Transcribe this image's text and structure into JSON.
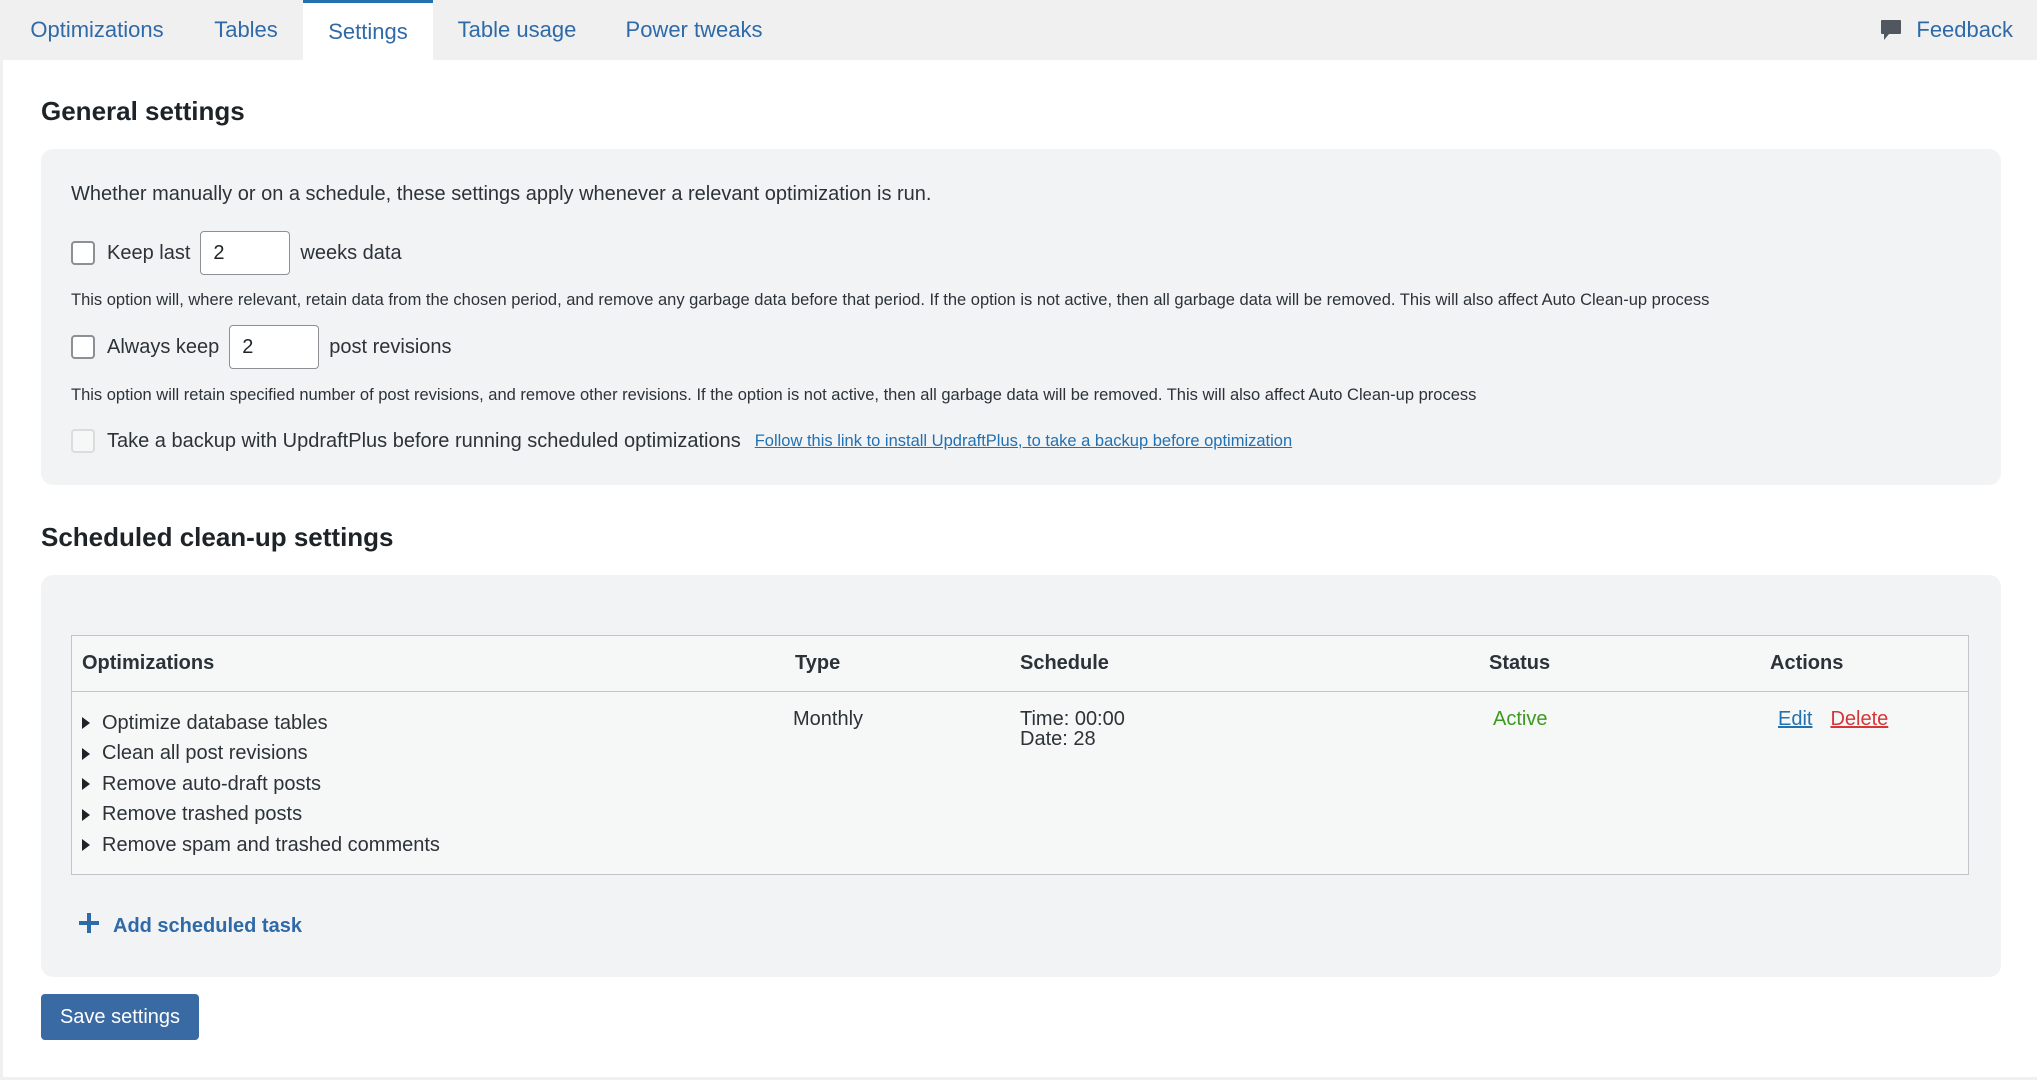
{
  "tabs": [
    {
      "label": "Optimizations",
      "active": false
    },
    {
      "label": "Tables",
      "active": false
    },
    {
      "label": "Settings",
      "active": true
    },
    {
      "label": "Table usage",
      "active": false
    },
    {
      "label": "Power tweaks",
      "active": false
    }
  ],
  "feedback": {
    "label": "Feedback",
    "icon": "speech-bubble-icon"
  },
  "general": {
    "title": "General settings",
    "intro": "Whether manually or on a schedule, these settings apply whenever a relevant optimization is run.",
    "keep_last": {
      "checked": false,
      "label_before": "Keep last",
      "value": "2",
      "label_after": "weeks data",
      "help": "This option will, where relevant, retain data from the chosen period, and remove any garbage data before that period. If the option is not active, then all garbage data will be removed. This will also affect Auto Clean-up process"
    },
    "always_keep": {
      "checked": false,
      "label_before": "Always keep",
      "value": "2",
      "label_after": "post revisions",
      "help": "This option will retain specified number of post revisions, and remove other revisions. If the option is not active, then all garbage data will be removed. This will also affect Auto Clean-up process"
    },
    "backup": {
      "checked": false,
      "disabled": true,
      "label": "Take a backup with UpdraftPlus before running scheduled optimizations",
      "link": "Follow this link to install UpdraftPlus, to take a backup before optimization"
    }
  },
  "scheduled": {
    "title": "Scheduled clean-up settings",
    "columns": {
      "optimizations": "Optimizations",
      "type": "Type",
      "schedule": "Schedule",
      "status": "Status",
      "actions": "Actions"
    },
    "row": {
      "optimizations": [
        "Optimize database tables",
        "Clean all post revisions",
        "Remove auto-draft posts",
        "Remove trashed posts",
        "Remove spam and trashed comments"
      ],
      "type": "Monthly",
      "schedule_time": "Time: 00:00",
      "schedule_date": "Date: 28",
      "status": "Active",
      "edit": "Edit",
      "delete": "Delete"
    },
    "add_task": "Add scheduled task"
  },
  "save_button": "Save settings",
  "colors": {
    "accent": "#2271b1",
    "status_active": "#3c9a1f",
    "delete": "#d63638",
    "save_button": "#3a6aa3"
  }
}
